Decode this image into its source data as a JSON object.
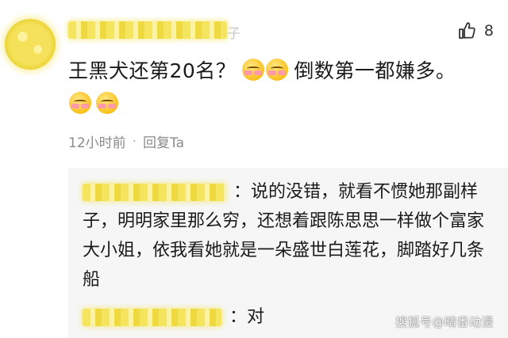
{
  "comment": {
    "username_suffix": "子",
    "like_count": "8",
    "text": "王黑犬还第20名？",
    "text_after": "倒数第一都嫌多。",
    "time": "12小时前",
    "separator": "·",
    "reply_action": "回复Ta"
  },
  "replies": [
    {
      "text": "：说的没错，就看不惯她那副样子，明明家里那么穷，还想着跟陈思思一样做个富家大小姐，依我看她就是一朵盛世白莲花，脚踏好几条船"
    },
    {
      "text": "：对"
    }
  ],
  "watermark": "搜狐号@晴番动漫",
  "icons": {
    "like": "thumbs-up-icon",
    "emoji": "blushing-face-emoji"
  }
}
